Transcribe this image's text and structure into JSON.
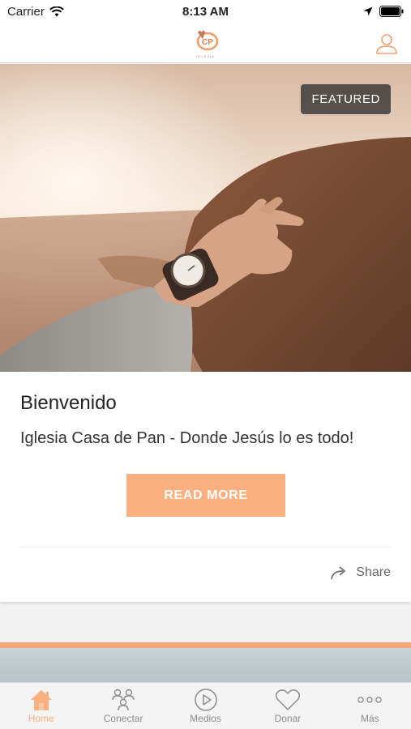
{
  "status_bar": {
    "carrier": "Carrier",
    "time": "8:13 AM"
  },
  "header": {
    "logo_text": "CP",
    "logo_subtext": "IGLESIA"
  },
  "card": {
    "badge": "FEATURED",
    "title": "Bienvenido",
    "subtitle": "Iglesia Casa de Pan - Donde Jesús lo es todo!",
    "button_label": "READ MORE",
    "share_label": "Share"
  },
  "tabs": [
    {
      "label": "Home",
      "icon": "house-icon",
      "active": true
    },
    {
      "label": "Conectar",
      "icon": "people-icon",
      "active": false
    },
    {
      "label": "Medios",
      "icon": "play-circle-icon",
      "active": false
    },
    {
      "label": "Donar",
      "icon": "heart-icon",
      "active": false
    },
    {
      "label": "Más",
      "icon": "more-dots-icon",
      "active": false
    }
  ],
  "colors": {
    "accent": "#fbb07f",
    "inactive": "#8c8c8c",
    "badge_bg": "#46423f"
  }
}
